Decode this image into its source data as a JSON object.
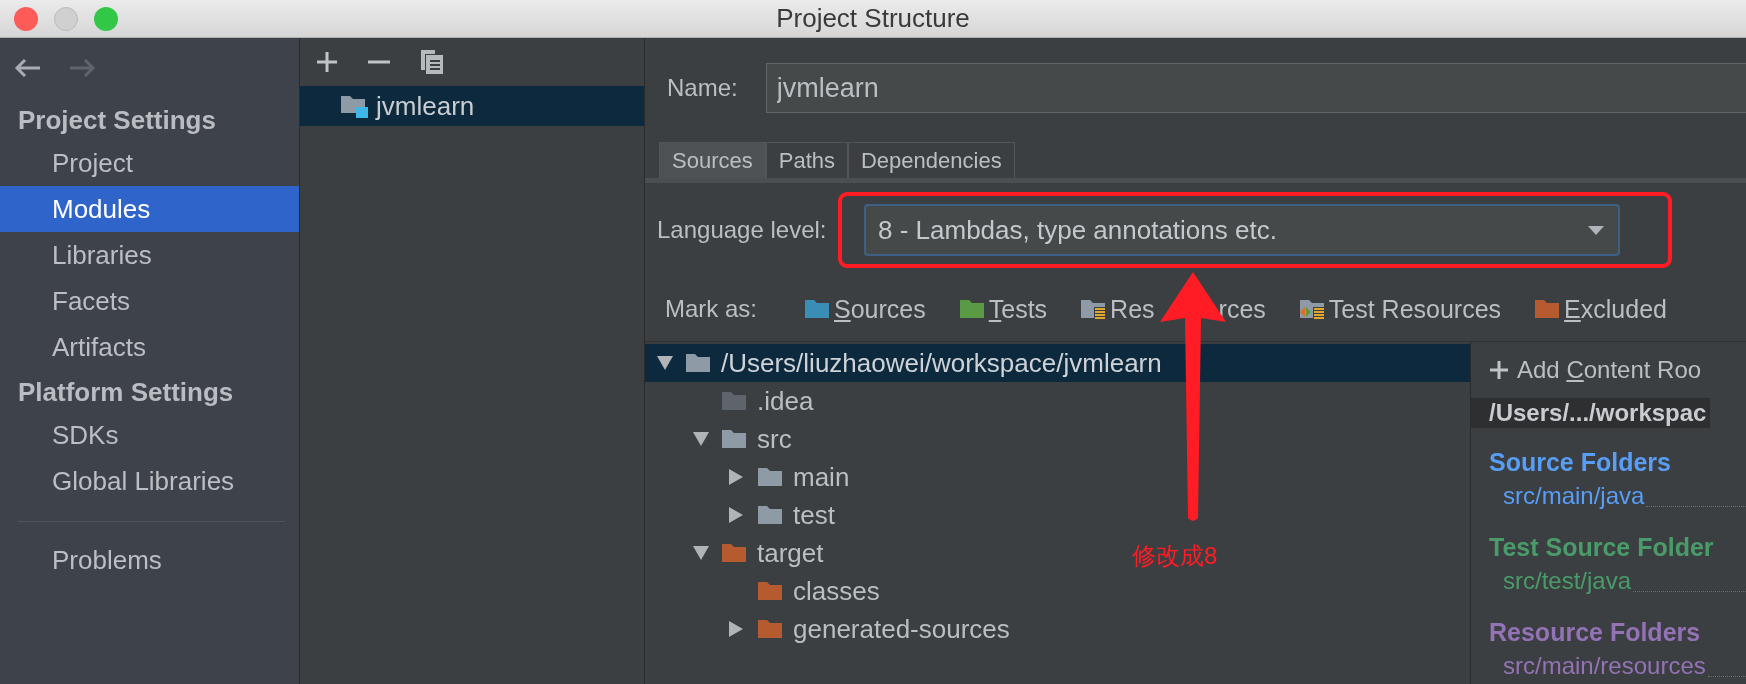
{
  "window": {
    "title": "Project Structure"
  },
  "sidebar": {
    "sections": [
      {
        "title": "Project Settings",
        "items": [
          {
            "label": "Project",
            "selected": false
          },
          {
            "label": "Modules",
            "selected": true
          },
          {
            "label": "Libraries",
            "selected": false
          },
          {
            "label": "Facets",
            "selected": false
          },
          {
            "label": "Artifacts",
            "selected": false
          }
        ]
      },
      {
        "title": "Platform Settings",
        "items": [
          {
            "label": "SDKs",
            "selected": false
          },
          {
            "label": "Global Libraries",
            "selected": false
          }
        ]
      }
    ],
    "bottom_items": [
      {
        "label": "Problems",
        "selected": false
      }
    ]
  },
  "modules": [
    {
      "name": "jvmlearn",
      "selected": true
    }
  ],
  "name_field": {
    "label": "Name:",
    "value": "jvmlearn"
  },
  "tabs": [
    {
      "label": "Sources",
      "selected": true
    },
    {
      "label": "Paths",
      "selected": false
    },
    {
      "label": "Dependencies",
      "selected": false
    }
  ],
  "language_level": {
    "label": "Language level:",
    "value": "8 - Lambdas, type annotations etc."
  },
  "mark_as": {
    "label": "Mark as:",
    "buttons": [
      {
        "kind": "sources",
        "key": "S",
        "after": "ources"
      },
      {
        "kind": "tests",
        "key": "T",
        "after": "ests"
      },
      {
        "kind": "resources",
        "parts": [
          "Res",
          "rces"
        ]
      },
      {
        "kind": "test_resources",
        "after": "Test Resources"
      },
      {
        "kind": "excluded",
        "key": "E",
        "after": "xcluded"
      }
    ]
  },
  "tree": [
    {
      "label": "/Users/liuzhaowei/workspace/jvmlearn",
      "kind": "plain",
      "expanded": true,
      "selected": true,
      "children": [
        {
          "label": ".idea",
          "kind": "hidden",
          "selected": false
        },
        {
          "label": "src",
          "kind": "plain",
          "expanded": true,
          "selected": false,
          "children": [
            {
              "label": "main",
              "kind": "plain",
              "expanded": false,
              "selected": false
            },
            {
              "label": "test",
              "kind": "plain",
              "expanded": false,
              "selected": false
            }
          ]
        },
        {
          "label": "target",
          "kind": "excluded",
          "expanded": true,
          "selected": false,
          "children": [
            {
              "label": "classes",
              "kind": "excluded",
              "selected": false
            },
            {
              "label": "generated-sources",
              "kind": "excluded",
              "expanded": false,
              "selected": false
            }
          ]
        }
      ]
    }
  ],
  "content_roots": {
    "add_button": {
      "before": "Add ",
      "key": "C",
      "after": "ontent Roo"
    },
    "path": "/Users/.../workspac",
    "groups": [
      {
        "title": "Source Folders",
        "color": "#589df6",
        "folders": [
          "src/main/java"
        ]
      },
      {
        "title": "Test Source Folder",
        "color": "#499c6a",
        "folders": [
          "src/test/java"
        ]
      },
      {
        "title": "Resource Folders",
        "color": "#9472b6",
        "folders": [
          "src/main/resources"
        ]
      }
    ]
  },
  "annotation": {
    "text": "修改成8"
  }
}
